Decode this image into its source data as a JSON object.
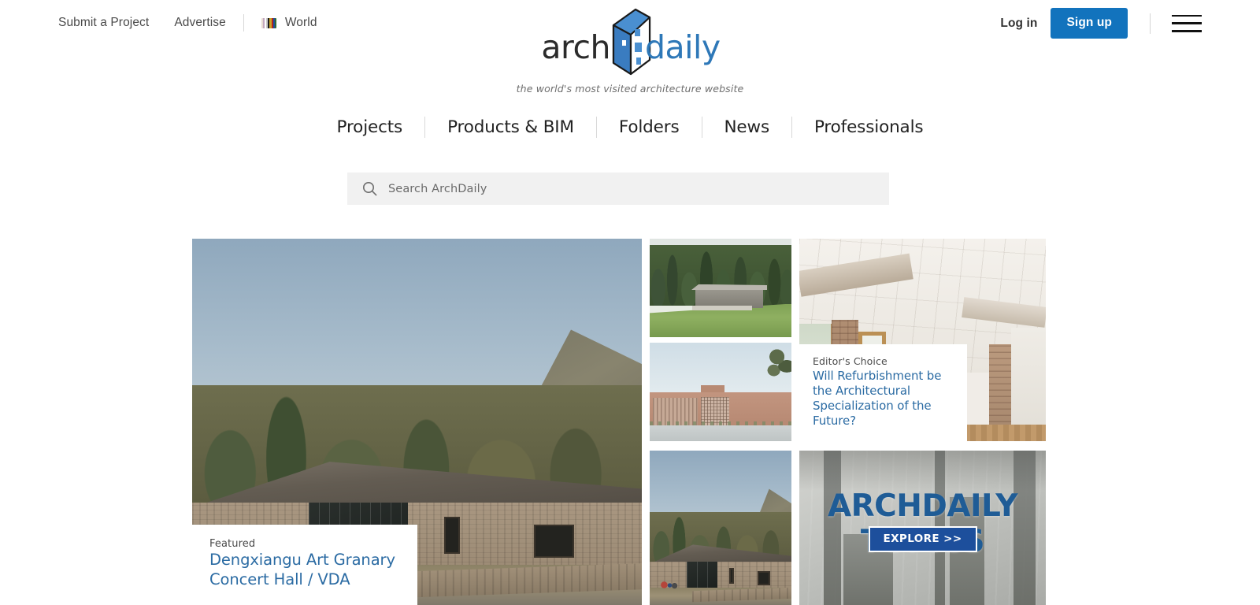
{
  "topbar": {
    "submit_label": "Submit a Project",
    "advertise_label": "Advertise",
    "world_label": "World",
    "login_label": "Log in",
    "signup_label": "Sign up",
    "flag_colors": [
      "#e8dcd2",
      "#c4a8c0",
      "#ffffff",
      "#c9c9c9",
      "#1f1f1f",
      "#c9a227",
      "#b5241f",
      "#1d4f9c",
      "#2e6b34",
      "#5a3a1f"
    ]
  },
  "logo": {
    "word_left": "arch",
    "word_right": "daily",
    "tagline": "the world's most visited architecture website"
  },
  "nav": {
    "items": [
      {
        "label": "Projects"
      },
      {
        "label": "Products & BIM"
      },
      {
        "label": "Folders"
      },
      {
        "label": "News"
      },
      {
        "label": "Professionals"
      }
    ]
  },
  "search": {
    "placeholder": "Search ArchDaily",
    "value": ""
  },
  "grid": {
    "hero": {
      "kicker": "Featured",
      "title": "Dengxiangu Art Granary Concert Hall / VDA"
    },
    "editors": {
      "kicker": "Editor's Choice",
      "title": "Will Refurbishment be the Architectural Specialization of the Future?"
    },
    "topics": {
      "title": "ARCHDAILY TOPICS",
      "cta": "EXPLORE >>"
    }
  },
  "colors": {
    "brand_blue": "#1273bd",
    "link_blue": "#2b6ba3",
    "logo_blue": "#2e78b8",
    "topics_blue": "#1f5c96",
    "search_bg": "#f1f1f1"
  }
}
